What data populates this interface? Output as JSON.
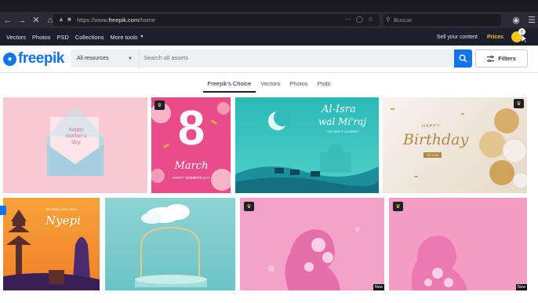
{
  "browser": {
    "url_prefix": "https://www.",
    "url_domain": "freepik.com",
    "url_path": "/home",
    "search_placeholder": "Buscar"
  },
  "topnav": {
    "items": [
      "Vectors",
      "Photos",
      "PSD",
      "Collections",
      "More tools"
    ],
    "sell": "Sell your content",
    "prices": "Prices",
    "coin_badge": "0"
  },
  "header": {
    "logo": "freepik",
    "resources_select": "All resources",
    "search_placeholder": "Search all assets",
    "filters_label": "Filters"
  },
  "tabs": [
    "Freepik's Choice",
    "Vectors",
    "Photos",
    "Psds"
  ],
  "tiles": {
    "t1_text": "happy mother's day",
    "t2_number": "8",
    "t2_word": "March",
    "t2_sub": "HAPPY WOMEN'S DAY",
    "t3_line1": "Al-Isra",
    "t3_line2": "wal Mi'raj",
    "t3_sub": "THE NIGHT JOURNEY",
    "t4_happy": "HAPPY",
    "t4_birthday": "Birthday",
    "t4_sub": "TO YOU",
    "t5_top": "SELAMAT HARI RAYA",
    "t5_word": "Nyepi",
    "new_label": "New"
  },
  "colors": {
    "brand": "#1273eb",
    "nav_bg": "#1a202c",
    "premium": "#f5c518"
  }
}
